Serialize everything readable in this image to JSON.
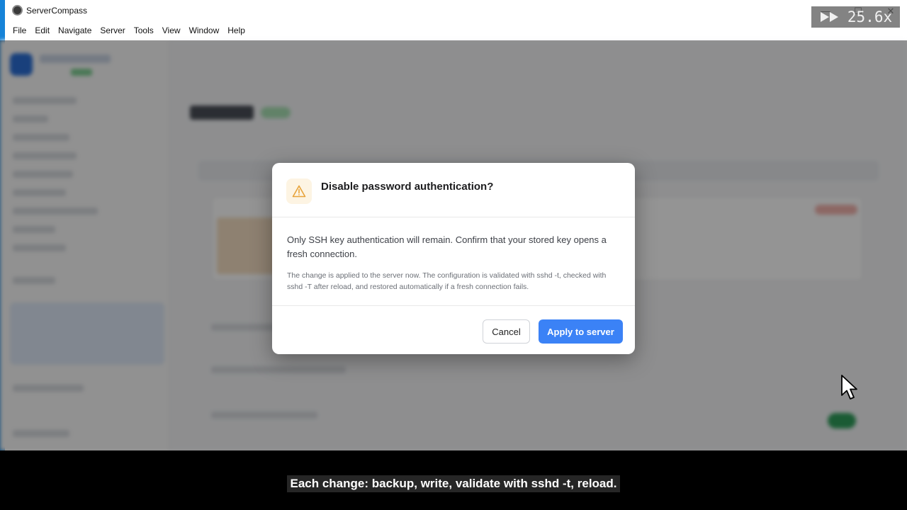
{
  "window": {
    "title": "ServerCompass",
    "controls": {
      "minimize": "—",
      "maximize": "☐",
      "close": "✕"
    }
  },
  "menu": [
    "File",
    "Edit",
    "Navigate",
    "Server",
    "Tools",
    "View",
    "Window",
    "Help"
  ],
  "dialog": {
    "icon": "warning-triangle-icon",
    "title": "Disable password authentication?",
    "message": "Only SSH key authentication will remain. Confirm that your stored key opens a fresh connection.",
    "note": "The change is applied to the server now. The configuration is validated with sshd -t, checked with sshd -T after reload, and restored automatically if a fresh connection fails.",
    "cancel_label": "Cancel",
    "apply_label": "Apply to server",
    "colors": {
      "accent": "#3b82f6",
      "warning": "#e8a33a"
    }
  },
  "overlay": {
    "speed": "25.6x"
  },
  "caption": "Each change: backup, write, validate with sshd -t, reload."
}
